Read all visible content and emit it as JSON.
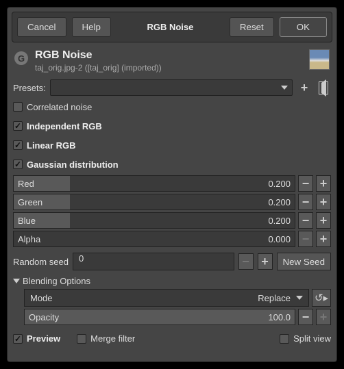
{
  "buttons": {
    "cancel": "Cancel",
    "help": "Help",
    "title": "RGB Noise",
    "reset": "Reset",
    "ok": "OK"
  },
  "header": {
    "title": "RGB Noise",
    "subtitle": "taj_orig.jpg-2 ([taj_orig] (imported))"
  },
  "presets_label": "Presets:",
  "checks": {
    "correlated": "Correlated noise",
    "independent": "Independent RGB",
    "linear": "Linear RGB",
    "gaussian": "Gaussian distribution"
  },
  "sliders": {
    "red": {
      "label": "Red",
      "value": "0.200",
      "fill": 20
    },
    "green": {
      "label": "Green",
      "value": "0.200",
      "fill": 20
    },
    "blue": {
      "label": "Blue",
      "value": "0.200",
      "fill": 20
    },
    "alpha": {
      "label": "Alpha",
      "value": "0.000",
      "fill": 0
    }
  },
  "seed": {
    "label": "Random seed",
    "value": "0",
    "new_seed": "New Seed"
  },
  "blending": {
    "header": "Blending Options",
    "mode_label": "Mode",
    "mode_value": "Replace",
    "opacity_label": "Opacity",
    "opacity_value": "100.0"
  },
  "footer": {
    "preview": "Preview",
    "merge": "Merge filter",
    "split": "Split view"
  }
}
